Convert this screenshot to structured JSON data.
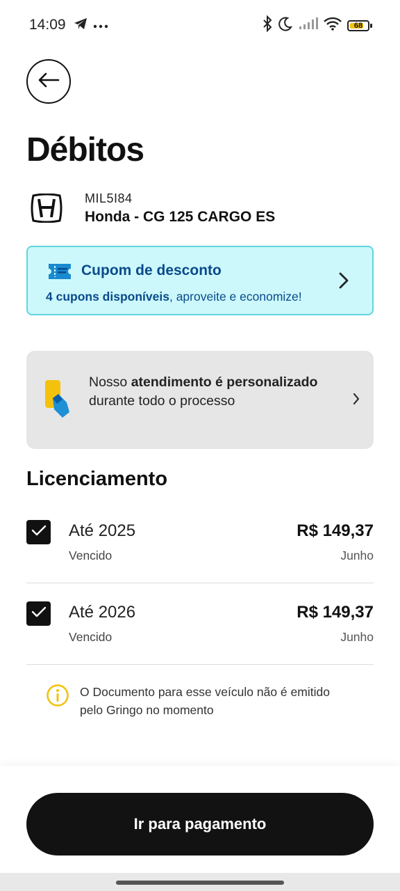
{
  "status_bar": {
    "time": "14:09",
    "battery": "68",
    "icons": [
      "telegram-icon",
      "more-dots-icon",
      "bluetooth-icon",
      "moon-icon",
      "signal-icon",
      "wifi-icon",
      "battery-icon"
    ]
  },
  "header": {
    "back_icon": "arrow-left-icon",
    "title": "Débitos"
  },
  "vehicle": {
    "brand_icon": "honda-logo-icon",
    "plate": "MIL5I84",
    "model": "Honda - CG 125 CARGO ES"
  },
  "coupon": {
    "icon": "ticket-icon",
    "title": "Cupom de desconto",
    "count_text": "4 cupons disponíveis",
    "rest_text": ", aproveite e economize!"
  },
  "support": {
    "icon": "phone-hand-icon",
    "text_1": "Nosso ",
    "text_bold_1": "atendimento é personalizado",
    "text_2": " durante todo o processo"
  },
  "section": {
    "title": "Licenciamento"
  },
  "debts": [
    {
      "title": "Até 2025",
      "status": "Vencido",
      "amount": "R$ 149,37",
      "month": "Junho",
      "checked": true
    },
    {
      "title": "Até 2026",
      "status": "Vencido",
      "amount": "R$ 149,37",
      "month": "Junho",
      "checked": true
    }
  ],
  "info": {
    "icon": "info-icon",
    "text": "O Documento para esse veículo não é emitido pelo Gringo no momento"
  },
  "footer": {
    "pay_label": "Ir para pagamento"
  },
  "colors": {
    "coupon_bg": "#ccf8fb",
    "coupon_border": "#5fd6dd",
    "coupon_text": "#0a4a8c",
    "support_bg": "#e6e6e6",
    "info_icon": "#f2c20c",
    "primary_button": "#121212"
  }
}
